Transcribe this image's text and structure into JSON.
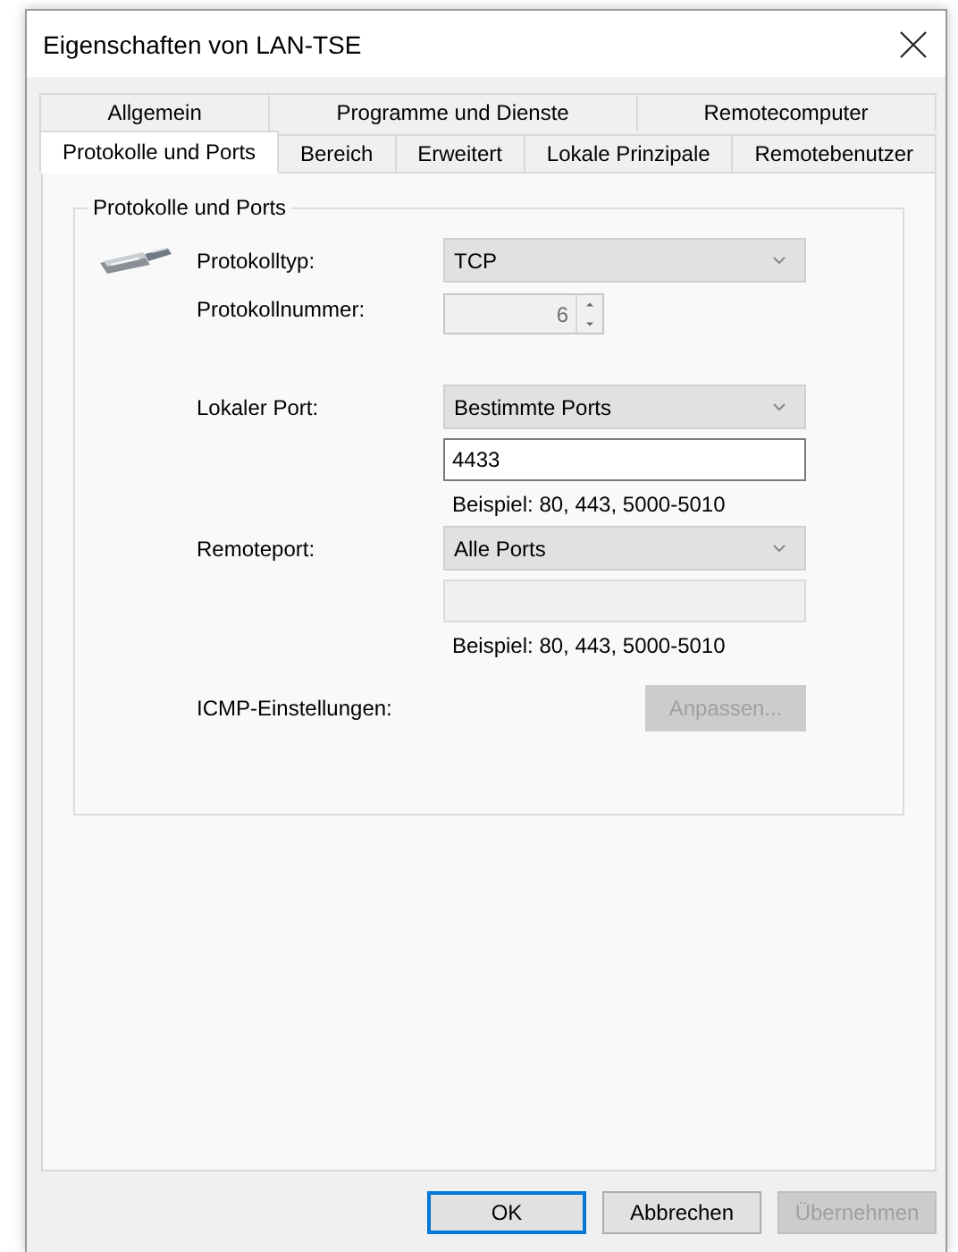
{
  "window": {
    "title": "Eigenschaften von LAN-TSE"
  },
  "tabs": [
    [
      {
        "label": "Allgemein",
        "selected": false
      },
      {
        "label": "Programme und Dienste",
        "selected": false
      },
      {
        "label": "Remotecomputer",
        "selected": false
      }
    ],
    [
      {
        "label": "Protokolle und Ports",
        "selected": true
      },
      {
        "label": "Bereich",
        "selected": false
      },
      {
        "label": "Erweitert",
        "selected": false
      },
      {
        "label": "Lokale Prinzipale",
        "selected": false
      },
      {
        "label": "Remotebenutzer",
        "selected": false
      }
    ]
  ],
  "group": {
    "title": "Protokolle und Ports",
    "rows": [
      {
        "kind": "combo",
        "label": "Protokolltyp:",
        "value": "TCP"
      },
      {
        "kind": "spin",
        "label": "Protokollnummer:",
        "value": "6",
        "disabled": true
      },
      {
        "kind": "combo",
        "label": "Lokaler Port:",
        "value": "Bestimmte Ports"
      },
      {
        "kind": "text",
        "value": "4433",
        "disabled": false
      },
      {
        "kind": "hint",
        "text": "Beispiel: 80, 443, 5000-5010"
      },
      {
        "kind": "combo",
        "label": "Remoteport:",
        "value": "Alle Ports"
      },
      {
        "kind": "text",
        "disabled": true
      },
      {
        "kind": "hint",
        "text": "Beispiel: 80, 443, 5000-5010"
      },
      {
        "kind": "button",
        "label": "ICMP-Einstellungen:",
        "text": "Anpassen...",
        "disabled": true
      }
    ]
  },
  "buttons": [
    {
      "label": "OK",
      "default": true,
      "disabled": false
    },
    {
      "label": "Abbrechen",
      "default": false,
      "disabled": false
    },
    {
      "label": "Übernehmen",
      "default": false,
      "disabled": true
    }
  ]
}
